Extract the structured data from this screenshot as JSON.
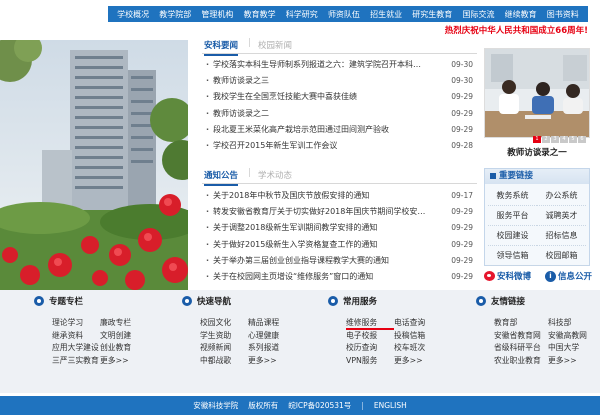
{
  "nav": [
    "学校概况",
    "教学院部",
    "管理机构",
    "教育教学",
    "科学研究",
    "师资队伍",
    "招生就业",
    "研究生教育",
    "国际交流",
    "继续教育",
    "图书资料"
  ],
  "banner": "热烈庆祝中华人民共和国成立66周年!",
  "news": {
    "tabs": [
      "安科要闻",
      "校园新闻"
    ],
    "items": [
      {
        "title": "学校落实本科生导师制系列报道之六：建筑学院召开本科…",
        "date": "09-30"
      },
      {
        "title": "教师访谈录之三",
        "date": "09-30"
      },
      {
        "title": "我校学生在全国烹饪技能大赛中喜获佳绩",
        "date": "09-29"
      },
      {
        "title": "教师访谈录之二",
        "date": "09-29"
      },
      {
        "title": "段北夏王米菜化高产栽培示范田通过田间测产验收",
        "date": "09-29"
      },
      {
        "title": "学校召开2015年新生军训工作会议",
        "date": "09-28"
      }
    ]
  },
  "notices": {
    "tabs": [
      "通知公告",
      "学术动态"
    ],
    "items": [
      {
        "title": "关于2018年中秋节及国庆节放假安排的通知",
        "date": "09-17"
      },
      {
        "title": "转发安徽省教育厅关于切实做好2018年国庆节期间学校安…",
        "date": "09-29"
      },
      {
        "title": "关于调整2018级新生军训期间教学安排的通知",
        "date": "09-29"
      },
      {
        "title": "关于做好2015级新生入学资格复查工作的通知",
        "date": "09-29"
      },
      {
        "title": "关于举办第三届创业创业指导课程教学大赛的通知",
        "date": "09-29"
      },
      {
        "title": "关于在校园网主页增设“维修服务”窗口的通知",
        "date": "09-29"
      }
    ]
  },
  "visit": {
    "caption": "教师访谈录之一",
    "dots": [
      "1",
      "2",
      "3",
      "4",
      "5",
      "6"
    ]
  },
  "links_box": {
    "title": "重要链接",
    "items": [
      "教务系统",
      "办公系统",
      "服务平台",
      "诚聘英才",
      "校园建设",
      "招标信息",
      "领导信箱",
      "校园邮箱"
    ]
  },
  "social": {
    "weibo": "安科微博",
    "info": "信息公开"
  },
  "sections": [
    {
      "title": "专题专栏",
      "items": [
        "理论学习",
        "廉政专栏",
        "继承资料",
        "文明创建",
        "应用大学建设",
        "创业教育",
        "三严三实教育",
        "更多>>"
      ]
    },
    {
      "title": "快速导航",
      "items": [
        "校园文化",
        "精品课程",
        "学生资助",
        "心理健康",
        "视频新闻",
        "系列报道",
        "中都战歌",
        "更多>>"
      ]
    },
    {
      "title": "常用服务",
      "items": [
        "维修服务",
        "电话查询",
        "电子校报",
        "投稿信箱",
        "校历查询",
        "校车班次",
        "VPN服务",
        "更多>>"
      ]
    },
    {
      "title": "友情链接",
      "items": [
        "教育部",
        "科技部",
        "安徽省教育网",
        "安徽高教网",
        "省级科研平台",
        "中国大学",
        "农业职业教育",
        "更多>>"
      ]
    }
  ],
  "footer": {
    "school": "安徽科技学院",
    "copyright": "版权所有",
    "icp": "皖ICP备020531号",
    "lang": "ENGLISH"
  },
  "colors": {
    "primary": "#1f73bf",
    "accent": "#e60012"
  }
}
